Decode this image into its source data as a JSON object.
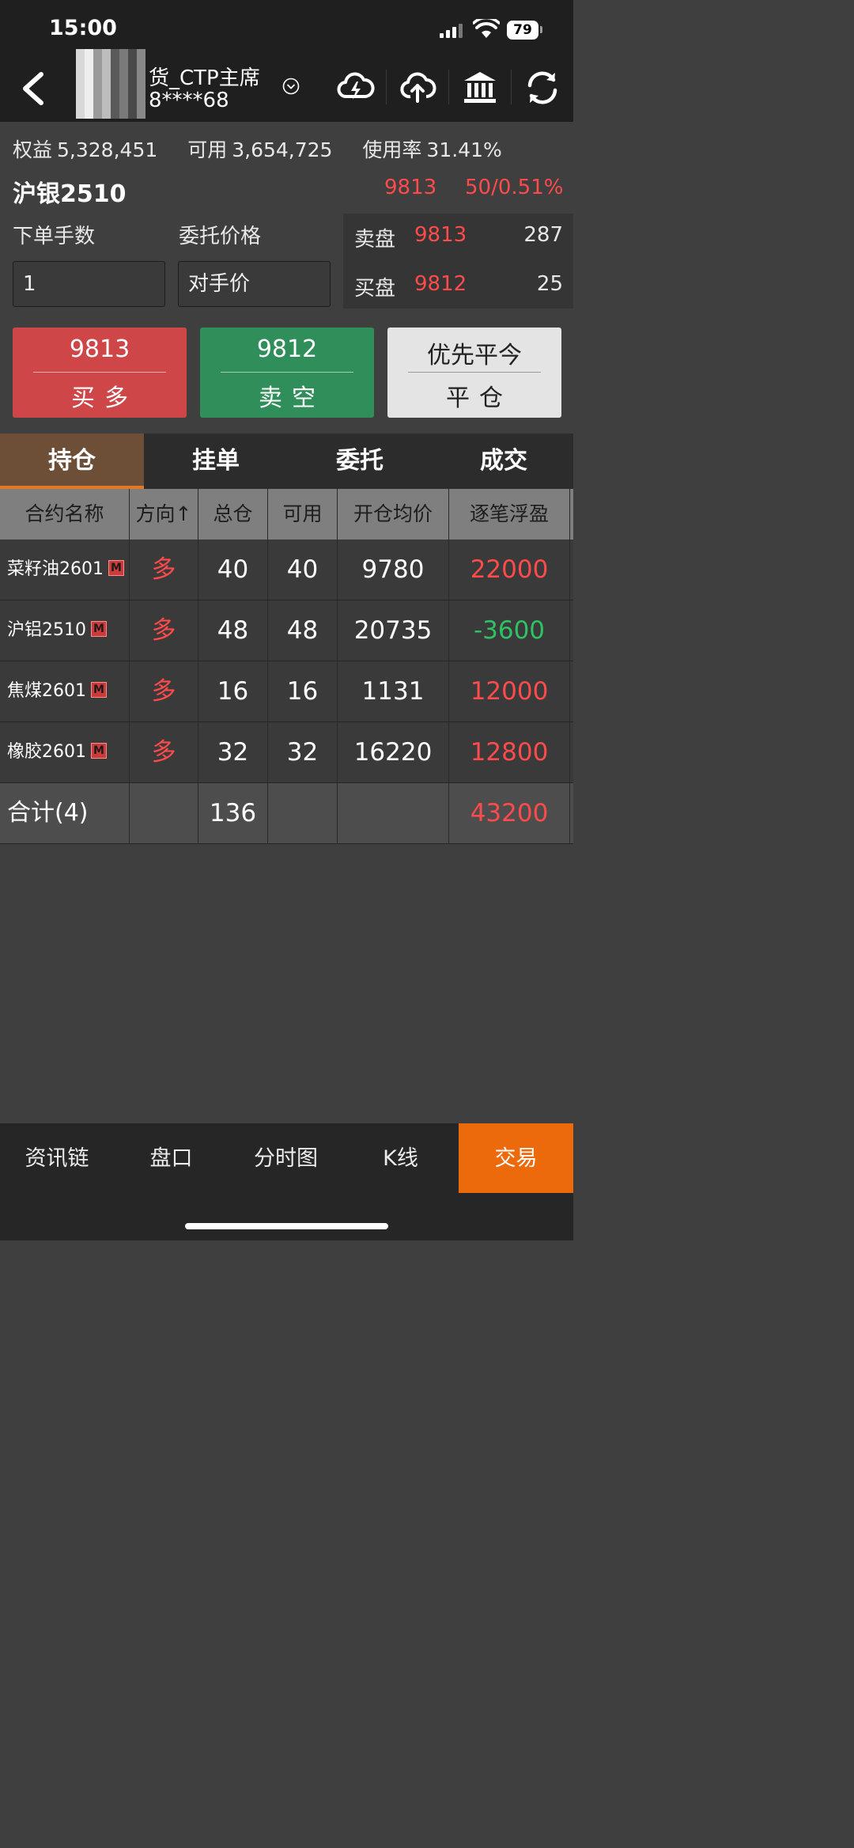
{
  "status_bar": {
    "time": "15:00",
    "battery": "79"
  },
  "header": {
    "title_line1": "货_CTP主席",
    "title_line2": "8****68",
    "icons": [
      "back-icon",
      "account-dropdown-icon",
      "cloud-lightning-icon",
      "cloud-upload-icon",
      "bank-icon",
      "refresh-icon"
    ]
  },
  "account": {
    "equity_label": "权益",
    "equity_value": "5,328,451",
    "available_label": "可用",
    "available_value": "3,654,725",
    "usage_label": "使用率",
    "usage_value": "31.41%"
  },
  "instrument": {
    "name": "沪银2510",
    "last_price": "9813",
    "change": "50/0.51%"
  },
  "order_form": {
    "qty_label": "下单手数",
    "price_label": "委托价格",
    "qty_value": "1",
    "price_value": "对手价"
  },
  "order_book": {
    "ask_label": "卖盘",
    "ask_price": "9813",
    "ask_volume": "287",
    "bid_label": "买盘",
    "bid_price": "9812",
    "bid_volume": "25"
  },
  "buttons": {
    "buy_price": "9813",
    "buy_label": "买多",
    "sell_price": "9812",
    "sell_label": "卖空",
    "close_mode": "优先平今",
    "close_label": "平仓"
  },
  "tabs": [
    "持仓",
    "挂单",
    "委托",
    "成交"
  ],
  "positions": {
    "headers": [
      "合约名称",
      "方向↑",
      "总仓",
      "可用",
      "开仓均价",
      "逐笔浮盈"
    ],
    "badge": "M",
    "rows": [
      {
        "name": "菜籽油2601",
        "dir": "多",
        "total": "40",
        "avail": "40",
        "avg": "9780",
        "pnl": "22000"
      },
      {
        "name": "沪铝2510",
        "dir": "多",
        "total": "48",
        "avail": "48",
        "avg": "20735",
        "pnl": "-3600"
      },
      {
        "name": "焦煤2601",
        "dir": "多",
        "total": "16",
        "avail": "16",
        "avg": "1131",
        "pnl": "12000"
      },
      {
        "name": "橡胶2601",
        "dir": "多",
        "total": "32",
        "avail": "32",
        "avg": "16220",
        "pnl": "12800"
      }
    ],
    "total_label": "合计(4)",
    "total_qty": "136",
    "total_pnl": "43200"
  },
  "bottom_nav": [
    "资讯链",
    "盘口",
    "分时图",
    "K线",
    "交易"
  ],
  "colors": {
    "up": "#ff4b4b",
    "down": "#2fc264",
    "buy_button": "#cf4648",
    "sell_button": "#2f8e59",
    "accent": "#ec6a0b",
    "tab_active": "#6d4f38"
  }
}
